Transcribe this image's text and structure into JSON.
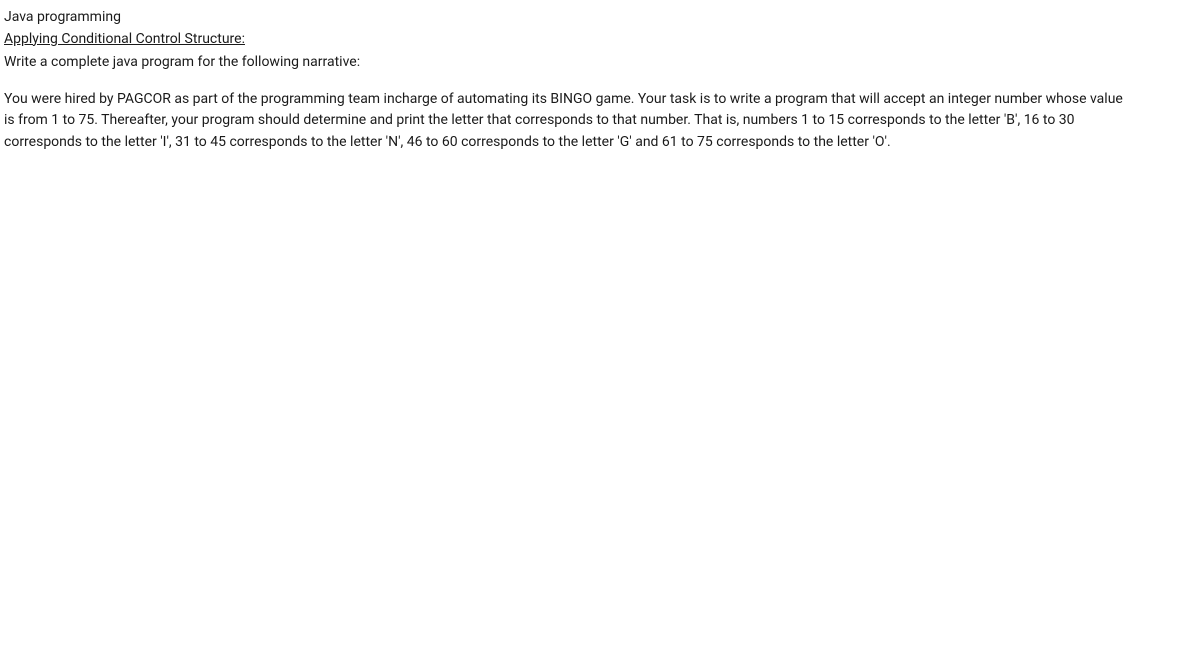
{
  "header": {
    "title": "Java programming",
    "subtitle": "Applying Conditional Control Structure:",
    "instruction": "Write a complete java program for the following narrative:"
  },
  "body": {
    "narrative": "You were hired by PAGCOR as part of the programming team incharge of automating its BINGO game. Your task is to write a program that will accept an integer number whose value is from 1 to 75. Thereafter, your program should determine and print the letter that corresponds to that number. That is, numbers 1 to 15 corresponds to the letter 'B', 16 to 30 corresponds to the letter 'I', 31 to 45 corresponds to the letter 'N', 46 to 60 corresponds to the letter 'G' and 61 to 75 corresponds to the letter 'O'."
  }
}
